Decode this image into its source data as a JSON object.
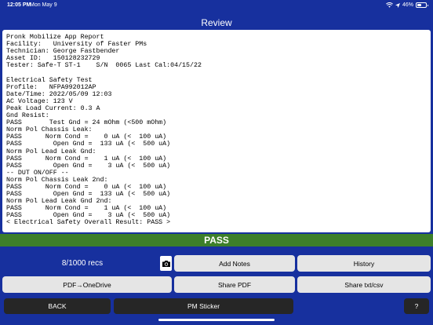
{
  "status_bar": {
    "time": "12:05 PM",
    "date": "Mon May 9",
    "battery_text": "46%",
    "battery_level": 0.46
  },
  "header": {
    "title": "Review"
  },
  "report": {
    "lines": [
      "Pronk Mobilize App Report",
      "Facility:   University of Faster PMs",
      "Technician: George Fastbender",
      "Asset ID:   150128232729",
      "Tester: Safe-T ST-1    S/N  0065 Last Cal:04/15/22",
      "",
      "Electrical Safety Test",
      "Profile:   NFPA992012AP",
      "Date/Time: 2022/05/09 12:03",
      "AC Voltage: 123 V",
      "Peak Load Current: 0.3 A",
      "Gnd Resist:",
      "PASS       Test Gnd = 24 mOhm (<500 mOhm)",
      "Norm Pol Chassis Leak:",
      "PASS      Norm Cond =    0 uA (<  100 uA)",
      "PASS        Open Gnd =  133 uA (<  500 uA)",
      "Norm Pol Lead Leak Gnd:",
      "PASS      Norm Cond =    1 uA (<  100 uA)",
      "PASS        Open Gnd =    3 uA (<  500 uA)",
      "-- DUT ON/OFF --",
      "Norm Pol Chassis Leak 2nd:",
      "PASS      Norm Cond =    0 uA (<  100 uA)",
      "PASS        Open Gnd =  133 uA (<  500 uA)",
      "Norm Pol Lead Leak Gnd 2nd:",
      "PASS      Norm Cond =    1 uA (<  100 uA)",
      "PASS        Open Gnd =    3 uA (<  500 uA)",
      "< Electrical Safety Overall Result: PASS >"
    ]
  },
  "result": {
    "label": "PASS",
    "color": "#3d7f2a"
  },
  "records": {
    "label": "8/1000 recs"
  },
  "buttons": {
    "add_notes": "Add Notes",
    "history": "History",
    "pdf_onedrive": "PDF→OneDrive",
    "share_pdf": "Share PDF",
    "share_txt_csv": "Share txt/csv",
    "back": "BACK",
    "pm_sticker": "PM Sticker",
    "help": "?"
  },
  "icons": {
    "camera": "camera-icon",
    "wifi": "wifi-icon",
    "battery": "battery-icon",
    "location": "location-icon"
  },
  "colors": {
    "background": "#17309e",
    "button_light": "#e5e5e5",
    "button_dark": "#262626"
  }
}
